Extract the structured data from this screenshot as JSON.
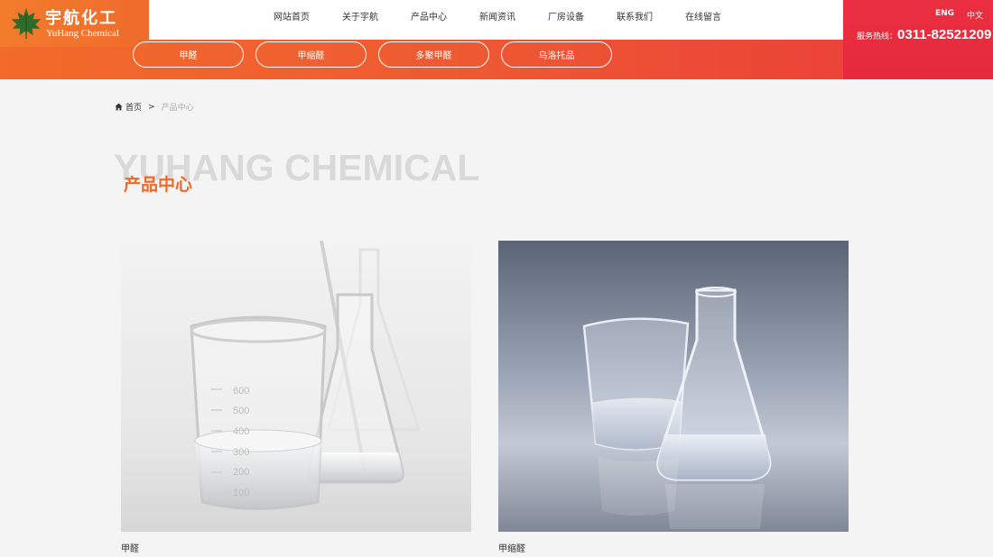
{
  "logo": {
    "cn": "宇航化工",
    "en": "YuHang Chemical"
  },
  "nav": {
    "items": [
      {
        "label": "网站首页"
      },
      {
        "label": "关于宇航"
      },
      {
        "label": "产品中心"
      },
      {
        "label": "新闻资讯"
      },
      {
        "label": "厂房设备"
      },
      {
        "label": "联系我们"
      },
      {
        "label": "在线留言"
      }
    ]
  },
  "lang": {
    "eng": "ENG",
    "zh": "中文"
  },
  "hotline": {
    "label": "服务热线：",
    "number": "0311-82521209"
  },
  "subnav": {
    "items": [
      {
        "label": "甲醛"
      },
      {
        "label": "甲缩醛"
      },
      {
        "label": "多聚甲醛"
      },
      {
        "label": "乌洛托品"
      }
    ]
  },
  "breadcrumb": {
    "home": "首页",
    "sep": ">",
    "current": "产品中心"
  },
  "section": {
    "bg_title": "YUHANG CHEMICAL",
    "title": "产品中心"
  },
  "products": [
    {
      "caption": "甲醛",
      "beaker_marks": [
        "600",
        "500",
        "400",
        "300",
        "200",
        "100"
      ]
    },
    {
      "caption": "甲缩醛"
    }
  ],
  "colors": {
    "orange": "#ef6a2a",
    "red": "#e52a3c",
    "bg": "#f4f4f4"
  }
}
